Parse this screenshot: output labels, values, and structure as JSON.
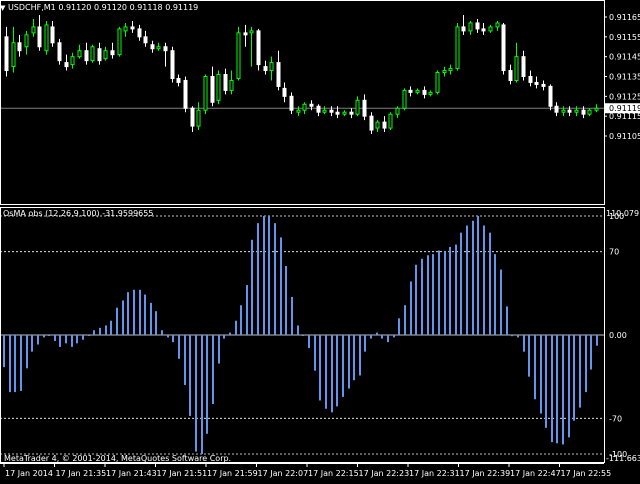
{
  "main_chart": {
    "title": "USDCHF,M1  0.91120 0.91120 0.91118 0.91119",
    "price_ticks": [
      "0.91165",
      "0.91155",
      "0.91145",
      "0.91135",
      "0.91125",
      "0.91115",
      "0.91105"
    ],
    "current_price": "0.91119",
    "colors": {
      "bull": "#00ff00",
      "bear": "#ffffff",
      "background": "#000000",
      "price_line": "#808080"
    }
  },
  "indicator": {
    "title": "OsMA obs (12,26,9,100) -31.9599655",
    "top_value": "110.0791",
    "bottom_value": "-111.6630",
    "levels": [
      "100",
      "70",
      "0.00",
      "-70",
      "-100"
    ],
    "bar_color": "#6495ed"
  },
  "time_ticks": [
    "17 Jan 2014",
    "17 Jan 21:35",
    "17 Jan 21:43",
    "17 Jan 21:51",
    "17 Jan 21:59",
    "17 Jan 22:07",
    "17 Jan 22:15",
    "17 Jan 22:23",
    "17 Jan 22:31",
    "17 Jan 22:39",
    "17 Jan 22:47",
    "17 Jan 22:55"
  ],
  "copyright": "MetaTrader 4, © 2001-2014, MetaQuotes Software Corp.",
  "chart_data": [
    {
      "type": "candlestick",
      "title": "USDCHF,M1",
      "ylim": [
        0.91101,
        0.91171
      ],
      "candles": [
        {
          "o": 0.91155,
          "h": 0.9116,
          "c": 0.91138,
          "l": 0.91135
        },
        {
          "o": 0.9114,
          "h": 0.9116,
          "c": 0.91152,
          "l": 0.91137
        },
        {
          "o": 0.91152,
          "h": 0.91156,
          "c": 0.91148,
          "l": 0.91145
        },
        {
          "o": 0.9115,
          "h": 0.91158,
          "c": 0.91156,
          "l": 0.91146
        },
        {
          "o": 0.91157,
          "h": 0.91164,
          "c": 0.9116,
          "l": 0.91155
        },
        {
          "o": 0.9116,
          "h": 0.91166,
          "c": 0.9115,
          "l": 0.91148
        },
        {
          "o": 0.91148,
          "h": 0.91163,
          "c": 0.91161,
          "l": 0.91146
        },
        {
          "o": 0.9116,
          "h": 0.91163,
          "c": 0.91152,
          "l": 0.9115
        },
        {
          "o": 0.91152,
          "h": 0.91154,
          "c": 0.91143,
          "l": 0.91141
        },
        {
          "o": 0.91142,
          "h": 0.91146,
          "c": 0.9114,
          "l": 0.91138
        },
        {
          "o": 0.91141,
          "h": 0.91147,
          "c": 0.91145,
          "l": 0.91139
        },
        {
          "o": 0.91145,
          "h": 0.91151,
          "c": 0.91148,
          "l": 0.91144
        },
        {
          "o": 0.91148,
          "h": 0.91152,
          "c": 0.91143,
          "l": 0.91141
        },
        {
          "o": 0.91143,
          "h": 0.91151,
          "c": 0.9115,
          "l": 0.91142
        },
        {
          "o": 0.91149,
          "h": 0.91152,
          "c": 0.91143,
          "l": 0.91141
        },
        {
          "o": 0.91144,
          "h": 0.9115,
          "c": 0.91148,
          "l": 0.91143
        },
        {
          "o": 0.91148,
          "h": 0.91152,
          "c": 0.91146,
          "l": 0.91144
        },
        {
          "o": 0.91146,
          "h": 0.9116,
          "c": 0.91159,
          "l": 0.91145
        },
        {
          "o": 0.91158,
          "h": 0.91162,
          "c": 0.9116,
          "l": 0.91155
        },
        {
          "o": 0.9116,
          "h": 0.91163,
          "c": 0.91159,
          "l": 0.91157
        },
        {
          "o": 0.91159,
          "h": 0.91161,
          "c": 0.91155,
          "l": 0.91153
        },
        {
          "o": 0.91155,
          "h": 0.91158,
          "c": 0.91152,
          "l": 0.9115
        },
        {
          "o": 0.91151,
          "h": 0.91153,
          "c": 0.91149,
          "l": 0.91147
        },
        {
          "o": 0.91149,
          "h": 0.91152,
          "c": 0.9115,
          "l": 0.91148
        },
        {
          "o": 0.9115,
          "h": 0.91152,
          "c": 0.91148,
          "l": 0.9114
        },
        {
          "o": 0.91148,
          "h": 0.9115,
          "c": 0.91134,
          "l": 0.91132
        },
        {
          "o": 0.91134,
          "h": 0.91136,
          "c": 0.91132,
          "l": 0.9113
        },
        {
          "o": 0.91133,
          "h": 0.91135,
          "c": 0.91119,
          "l": 0.91117
        },
        {
          "o": 0.91119,
          "h": 0.9112,
          "c": 0.9111,
          "l": 0.91107
        },
        {
          "o": 0.9111,
          "h": 0.91122,
          "c": 0.91118,
          "l": 0.91108
        },
        {
          "o": 0.91118,
          "h": 0.91136,
          "c": 0.91135,
          "l": 0.91116
        },
        {
          "o": 0.91135,
          "h": 0.9114,
          "c": 0.91122,
          "l": 0.9112
        },
        {
          "o": 0.91123,
          "h": 0.91138,
          "c": 0.91136,
          "l": 0.91121
        },
        {
          "o": 0.91136,
          "h": 0.91139,
          "c": 0.91128,
          "l": 0.91126
        },
        {
          "o": 0.91128,
          "h": 0.91138,
          "c": 0.91133,
          "l": 0.91126
        },
        {
          "o": 0.91134,
          "h": 0.9116,
          "c": 0.91157,
          "l": 0.91133
        },
        {
          "o": 0.91157,
          "h": 0.91161,
          "c": 0.91156,
          "l": 0.9115
        },
        {
          "o": 0.91157,
          "h": 0.9116,
          "c": 0.91158,
          "l": 0.9114
        },
        {
          "o": 0.91158,
          "h": 0.91159,
          "c": 0.91141,
          "l": 0.91138
        },
        {
          "o": 0.9114,
          "h": 0.91143,
          "c": 0.91138,
          "l": 0.91136
        },
        {
          "o": 0.91138,
          "h": 0.91145,
          "c": 0.91142,
          "l": 0.91133
        },
        {
          "o": 0.91142,
          "h": 0.91148,
          "c": 0.9113,
          "l": 0.91128
        },
        {
          "o": 0.91129,
          "h": 0.91132,
          "c": 0.91125,
          "l": 0.91122
        },
        {
          "o": 0.91125,
          "h": 0.91127,
          "c": 0.91118,
          "l": 0.91116
        },
        {
          "o": 0.91117,
          "h": 0.9112,
          "c": 0.91118,
          "l": 0.91115
        },
        {
          "o": 0.91118,
          "h": 0.91122,
          "c": 0.91121,
          "l": 0.91116
        },
        {
          "o": 0.91121,
          "h": 0.91123,
          "c": 0.9112,
          "l": 0.91118
        },
        {
          "o": 0.9112,
          "h": 0.91121,
          "c": 0.91117,
          "l": 0.91115
        },
        {
          "o": 0.91117,
          "h": 0.9112,
          "c": 0.91118,
          "l": 0.91116
        },
        {
          "o": 0.91118,
          "h": 0.9112,
          "c": 0.91117,
          "l": 0.91115
        },
        {
          "o": 0.91117,
          "h": 0.9112,
          "c": 0.91116,
          "l": 0.91114
        },
        {
          "o": 0.91116,
          "h": 0.91118,
          "c": 0.91117,
          "l": 0.91115
        },
        {
          "o": 0.91117,
          "h": 0.91119,
          "c": 0.91116,
          "l": 0.91114
        },
        {
          "o": 0.91116,
          "h": 0.91125,
          "c": 0.91123,
          "l": 0.91115
        },
        {
          "o": 0.91123,
          "h": 0.91126,
          "c": 0.91115,
          "l": 0.91113
        },
        {
          "o": 0.91115,
          "h": 0.91117,
          "c": 0.91108,
          "l": 0.91106
        },
        {
          "o": 0.91109,
          "h": 0.91113,
          "c": 0.91112,
          "l": 0.91107
        },
        {
          "o": 0.91112,
          "h": 0.91115,
          "c": 0.91109,
          "l": 0.91107
        },
        {
          "o": 0.91109,
          "h": 0.91117,
          "c": 0.91116,
          "l": 0.91108
        },
        {
          "o": 0.91116,
          "h": 0.9112,
          "c": 0.91119,
          "l": 0.91114
        },
        {
          "o": 0.91119,
          "h": 0.91129,
          "c": 0.91128,
          "l": 0.91118
        },
        {
          "o": 0.91128,
          "h": 0.9113,
          "c": 0.91127,
          "l": 0.91125
        },
        {
          "o": 0.91127,
          "h": 0.91129,
          "c": 0.91128,
          "l": 0.91126
        },
        {
          "o": 0.91128,
          "h": 0.9113,
          "c": 0.91126,
          "l": 0.91124
        },
        {
          "o": 0.91126,
          "h": 0.91128,
          "c": 0.91127,
          "l": 0.91125
        },
        {
          "o": 0.91127,
          "h": 0.91138,
          "c": 0.91137,
          "l": 0.91126
        },
        {
          "o": 0.91137,
          "h": 0.9114,
          "c": 0.91138,
          "l": 0.91135
        },
        {
          "o": 0.91138,
          "h": 0.91141,
          "c": 0.91139,
          "l": 0.91136
        },
        {
          "o": 0.91139,
          "h": 0.91162,
          "c": 0.9116,
          "l": 0.91138
        },
        {
          "o": 0.9116,
          "h": 0.91166,
          "c": 0.91158,
          "l": 0.91156
        },
        {
          "o": 0.91158,
          "h": 0.91163,
          "c": 0.91162,
          "l": 0.91156
        },
        {
          "o": 0.91162,
          "h": 0.91164,
          "c": 0.91159,
          "l": 0.91157
        },
        {
          "o": 0.91159,
          "h": 0.91162,
          "c": 0.91158,
          "l": 0.91156
        },
        {
          "o": 0.91158,
          "h": 0.91161,
          "c": 0.9116,
          "l": 0.91157
        },
        {
          "o": 0.9116,
          "h": 0.91163,
          "c": 0.91162,
          "l": 0.91158
        },
        {
          "o": 0.91161,
          "h": 0.91162,
          "c": 0.91138,
          "l": 0.91136
        },
        {
          "o": 0.91138,
          "h": 0.91141,
          "c": 0.91133,
          "l": 0.91131
        },
        {
          "o": 0.91133,
          "h": 0.91152,
          "c": 0.91145,
          "l": 0.91132
        },
        {
          "o": 0.91145,
          "h": 0.91148,
          "c": 0.91135,
          "l": 0.91133
        },
        {
          "o": 0.91135,
          "h": 0.91138,
          "c": 0.91132,
          "l": 0.9113
        },
        {
          "o": 0.91132,
          "h": 0.91135,
          "c": 0.91131,
          "l": 0.91129
        },
        {
          "o": 0.91131,
          "h": 0.91133,
          "c": 0.9113,
          "l": 0.91128
        },
        {
          "o": 0.9113,
          "h": 0.91131,
          "c": 0.9112,
          "l": 0.91118
        },
        {
          "o": 0.9112,
          "h": 0.91122,
          "c": 0.91117,
          "l": 0.91115
        },
        {
          "o": 0.91117,
          "h": 0.9112,
          "c": 0.91118,
          "l": 0.91115
        },
        {
          "o": 0.91118,
          "h": 0.9112,
          "c": 0.91117,
          "l": 0.91115
        },
        {
          "o": 0.91117,
          "h": 0.9112,
          "c": 0.91118,
          "l": 0.91115
        },
        {
          "o": 0.91118,
          "h": 0.9112,
          "c": 0.91116,
          "l": 0.91114
        },
        {
          "o": 0.91116,
          "h": 0.91119,
          "c": 0.91118,
          "l": 0.91115
        },
        {
          "o": 0.91118,
          "h": 0.91121,
          "c": 0.91119,
          "l": 0.91117
        }
      ]
    },
    {
      "type": "bar",
      "title": "OsMA obs (12,26,9,100)",
      "ylim": [
        -111.663,
        110.0791
      ],
      "levels": [
        100,
        70,
        0,
        -70,
        -100
      ],
      "values": [
        -27,
        -48,
        -48,
        -47,
        -28,
        -14,
        -8,
        -2,
        0,
        -5,
        -10,
        -7,
        -10,
        -7,
        -4,
        0,
        4,
        6,
        8,
        12,
        23,
        29,
        36,
        38,
        38,
        34,
        27,
        20,
        4,
        -2,
        -6,
        -20,
        -42,
        -68,
        -98,
        -100,
        -83,
        -58,
        -24,
        -3,
        2,
        12,
        25,
        42,
        80,
        94,
        100,
        100,
        94,
        82,
        58,
        32,
        8,
        0,
        -11,
        -30,
        -55,
        -62,
        -65,
        -60,
        -52,
        -45,
        -38,
        -34,
        -14,
        -3,
        2,
        -3,
        -6,
        -2,
        14,
        25,
        45,
        59,
        64,
        67,
        68,
        71,
        70,
        74,
        76,
        86,
        92,
        96,
        100,
        92,
        86,
        68,
        55,
        24,
        -1,
        -2,
        -14,
        -35,
        -54,
        -66,
        -78,
        -90,
        -91,
        -92,
        -86,
        -72,
        -61,
        -48,
        -29,
        -9
      ]
    }
  ]
}
